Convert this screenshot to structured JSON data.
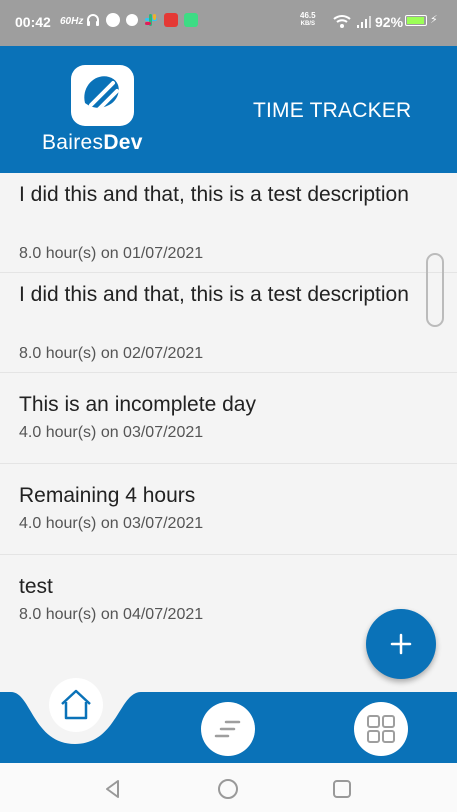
{
  "status_bar": {
    "time": "00:42",
    "refresh_rate": "60Hz",
    "net_speed_value": "46.5",
    "net_speed_unit": "KB/S",
    "battery": "92%",
    "battery_level": 0.92,
    "icons": [
      "headphones-icon",
      "fire-icon",
      "grammarly-icon",
      "slack-icon",
      "screen-mirror-icon",
      "android-icon",
      "wifi-icon",
      "signal-icon",
      "battery-icon"
    ]
  },
  "header": {
    "brand_regular": "Baires",
    "brand_bold": "Dev",
    "title": "TIME TRACKER"
  },
  "entries": [
    {
      "description": "I did this and that, this is a test description",
      "hours": "8.0 hour(s) on 01/07/2021"
    },
    {
      "description": "I did this and that, this is a test description",
      "hours": "8.0 hour(s) on 02/07/2021"
    },
    {
      "description": "This is an incomplete day",
      "hours": "4.0 hour(s) on 03/07/2021"
    },
    {
      "description": "Remaining 4 hours",
      "hours": "4.0 hour(s) on 03/07/2021"
    },
    {
      "description": "test",
      "hours": "8.0 hour(s) on 04/07/2021"
    }
  ],
  "fab": {
    "icon": "plus-icon"
  },
  "bottom_nav": {
    "items": [
      {
        "icon": "home-icon",
        "active": true
      },
      {
        "icon": "filter-list-icon",
        "active": false
      },
      {
        "icon": "grid-icon",
        "active": false
      }
    ]
  },
  "colors": {
    "brand": "#0a72b8",
    "status_bar": "#9e9e9e",
    "list_bg": "#f4f4f4"
  }
}
